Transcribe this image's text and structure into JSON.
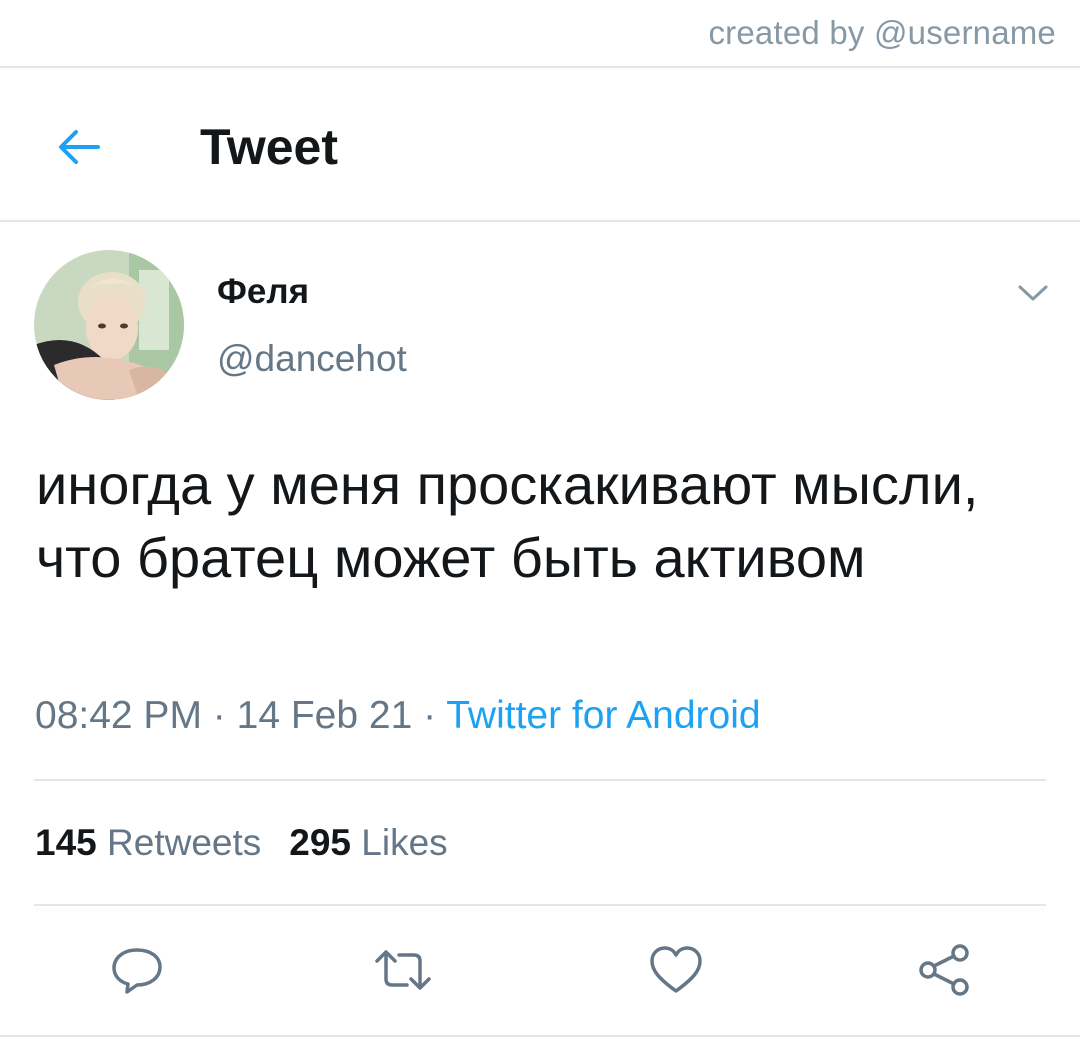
{
  "watermark": "created by @username",
  "header": {
    "title": "Tweet",
    "back_icon": "arrow-left-icon"
  },
  "tweet": {
    "author": {
      "display_name": "Феля",
      "handle": "@dancehot"
    },
    "text": "иногда у меня проскакивают мысли, что братец может быть активом",
    "time": "08:42 PM",
    "date": "14 Feb 21",
    "separator": "·",
    "source": "Twitter for Android",
    "retweets": {
      "count": "145",
      "label": "Retweets"
    },
    "likes": {
      "count": "295",
      "label": "Likes"
    }
  },
  "actions": [
    "reply-icon",
    "retweet-icon",
    "like-icon",
    "share-icon"
  ],
  "colors": {
    "accent": "#1da1f2",
    "secondary_text": "#657786",
    "primary_text": "#14171a",
    "divider": "#e1e8ed",
    "icon_gray": "#657786"
  }
}
